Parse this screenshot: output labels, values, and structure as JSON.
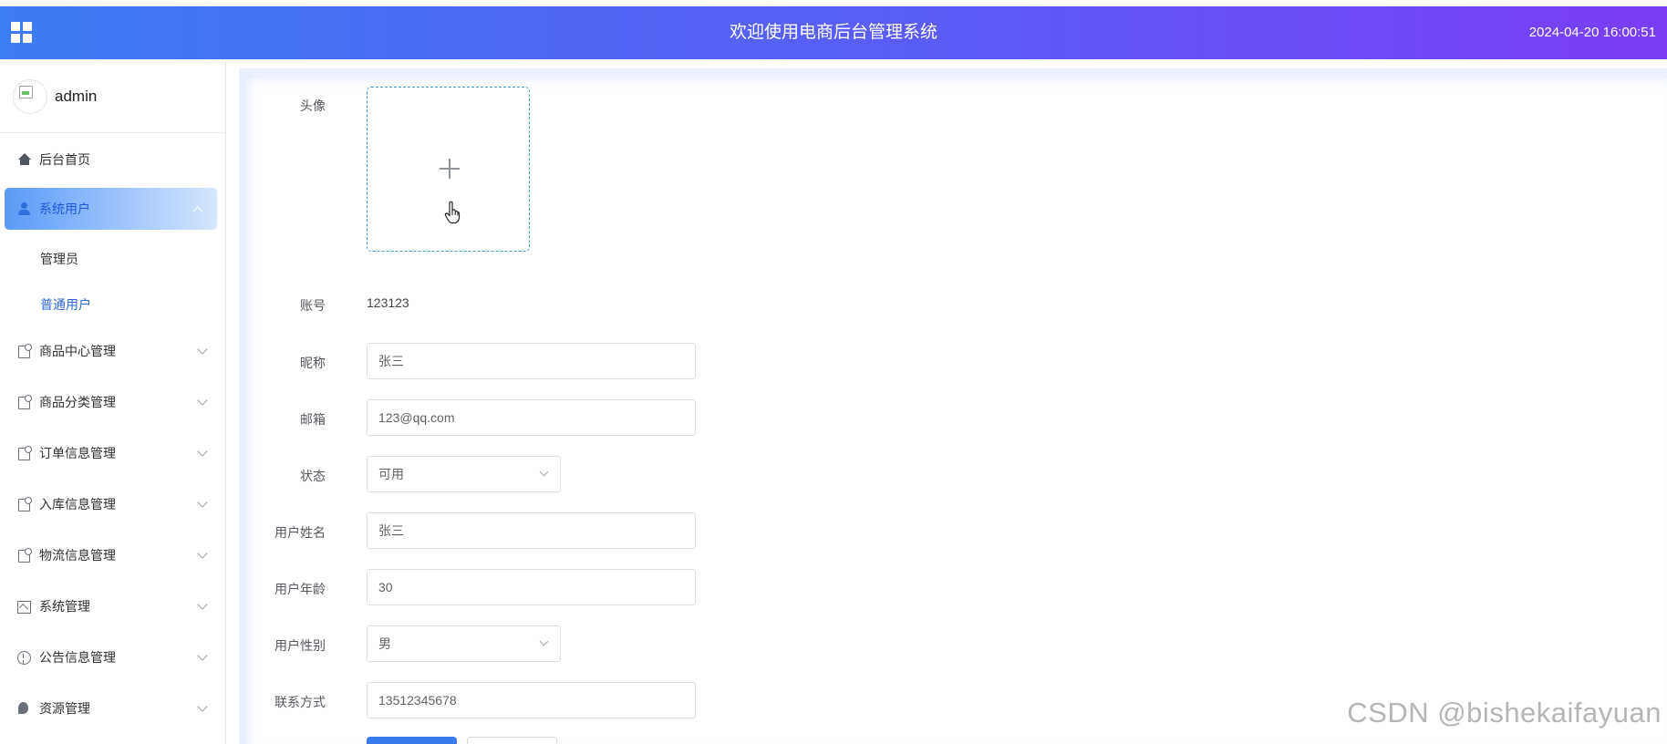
{
  "header": {
    "title": "欢迎使用电商后台管理系统",
    "datetime": "2024-04-20 16:00:51"
  },
  "sidebar": {
    "username": "admin",
    "items": [
      {
        "label": "后台首页",
        "icon": "home-icon"
      },
      {
        "label": "系统用户",
        "icon": "user-icon",
        "expanded": true,
        "children": [
          {
            "label": "管理员"
          },
          {
            "label": "普通用户",
            "active": true
          }
        ]
      },
      {
        "label": "商品中心管理",
        "icon": "document-icon"
      },
      {
        "label": "商品分类管理",
        "icon": "document-icon"
      },
      {
        "label": "订单信息管理",
        "icon": "document-icon"
      },
      {
        "label": "入库信息管理",
        "icon": "document-icon"
      },
      {
        "label": "物流信息管理",
        "icon": "document-icon"
      },
      {
        "label": "系统管理",
        "icon": "picture-icon"
      },
      {
        "label": "公告信息管理",
        "icon": "info-icon"
      },
      {
        "label": "资源管理",
        "icon": "leaf-icon"
      }
    ]
  },
  "form": {
    "avatar_label": "头像",
    "account_label": "账号",
    "account_value": "123123",
    "nickname_label": "昵称",
    "nickname_value": "张三",
    "email_label": "邮箱",
    "email_value": "123@qq.com",
    "status_label": "状态",
    "status_value": "可用",
    "name_label": "用户姓名",
    "name_value": "张三",
    "age_label": "用户年龄",
    "age_value": "30",
    "gender_label": "用户性别",
    "gender_value": "男",
    "phone_label": "联系方式",
    "phone_value": "13512345678"
  },
  "watermark": "CSDN @bishekaifayuan",
  "colors": {
    "header_start": "#3d7df5",
    "header_end": "#7a3df4",
    "active_text": "#2c69d8",
    "upload_border": "#3a9ad8"
  }
}
